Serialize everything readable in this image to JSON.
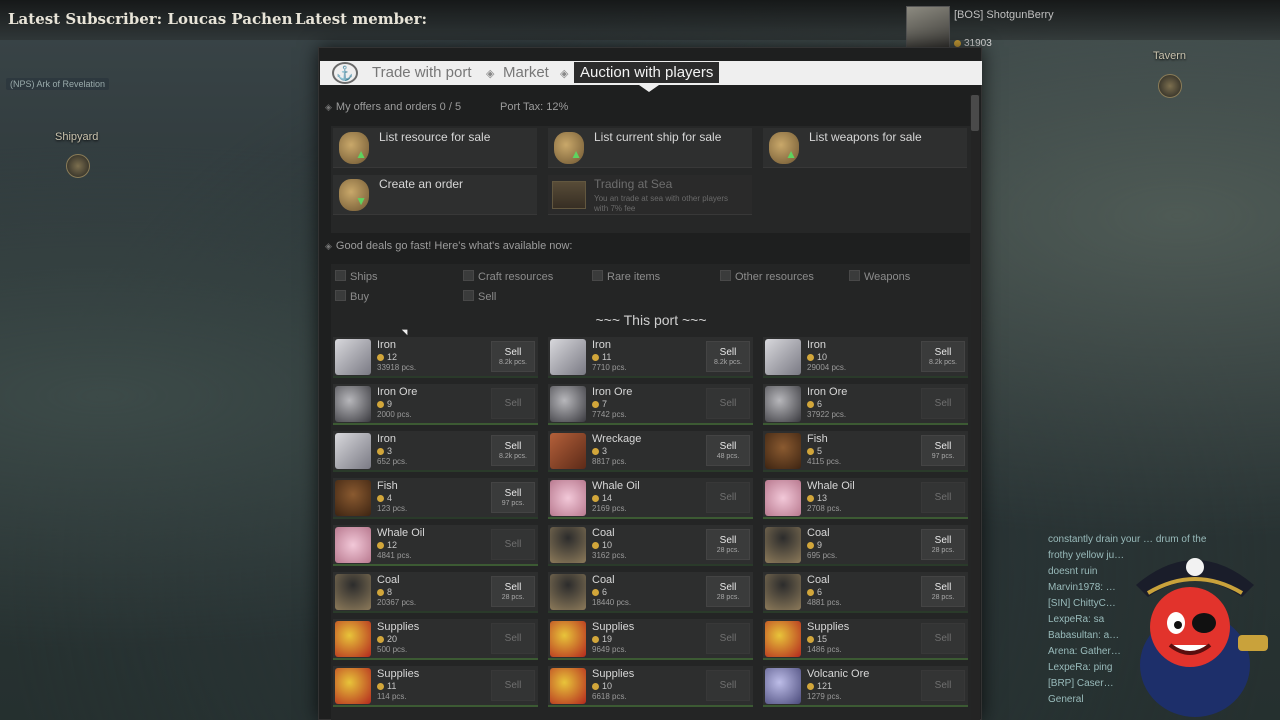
{
  "stream": {
    "latest_subscriber": "Latest Subscriber: Loucas Pachen",
    "latest_member": "Latest member:"
  },
  "player": {
    "name": "[BOS] ShotgunBerry",
    "coins": "31903"
  },
  "map": {
    "shipyard": "Shipyard",
    "tavern": "Tavern",
    "nps_label": "(NPS) Ark of Revelation"
  },
  "breadcrumb": {
    "trade": "Trade with port",
    "market": "Market",
    "auction": "Auction with players"
  },
  "offers": {
    "header": "My offers and orders 0 / 5",
    "tax": "Port Tax: 12%"
  },
  "actions": [
    {
      "label": "List resource for sale",
      "arrow": "up",
      "sub": ""
    },
    {
      "label": "List current ship for sale",
      "arrow": "up",
      "sub": ""
    },
    {
      "label": "List weapons for sale",
      "arrow": "up",
      "sub": ""
    },
    {
      "label": "Create an order",
      "arrow": "down",
      "sub": ""
    },
    {
      "label": "Trading at Sea",
      "arrow": "",
      "sub": "You an trade at sea with other players with 7% fee"
    }
  ],
  "deals_header": "Good deals go fast! Here's what's available now:",
  "filters": [
    "Ships",
    "Craft resources",
    "Rare items",
    "Other resources",
    "Weapons",
    "Buy",
    "Sell"
  ],
  "port_title": "~~~ This port ~~~",
  "items": [
    {
      "name": "Iron",
      "price": "12",
      "qty": "33918 pcs.",
      "sell": "Sell",
      "stock": "8.2k pcs.",
      "enabled": true,
      "icon": "iron-icon"
    },
    {
      "name": "Iron",
      "price": "11",
      "qty": "7710 pcs.",
      "sell": "Sell",
      "stock": "8.2k pcs.",
      "enabled": true,
      "icon": "iron-icon"
    },
    {
      "name": "Iron",
      "price": "10",
      "qty": "29004 pcs.",
      "sell": "Sell",
      "stock": "8.2k pcs.",
      "enabled": true,
      "icon": "iron-icon"
    },
    {
      "name": "Iron Ore",
      "price": "9",
      "qty": "2000 pcs.",
      "sell": "Sell",
      "stock": "",
      "enabled": false,
      "icon": "iron-ore-icon"
    },
    {
      "name": "Iron Ore",
      "price": "7",
      "qty": "7742 pcs.",
      "sell": "Sell",
      "stock": "",
      "enabled": false,
      "icon": "iron-ore-icon"
    },
    {
      "name": "Iron Ore",
      "price": "6",
      "qty": "37922 pcs.",
      "sell": "Sell",
      "stock": "",
      "enabled": false,
      "icon": "iron-ore-icon"
    },
    {
      "name": "Iron",
      "price": "3",
      "qty": "652 pcs.",
      "sell": "Sell",
      "stock": "8.2k pcs.",
      "enabled": true,
      "icon": "iron-icon"
    },
    {
      "name": "Wreckage",
      "price": "3",
      "qty": "8817 pcs.",
      "sell": "Sell",
      "stock": "48 pcs.",
      "enabled": true,
      "icon": "wreckage-icon"
    },
    {
      "name": "Fish",
      "price": "5",
      "qty": "4115 pcs.",
      "sell": "Sell",
      "stock": "97 pcs.",
      "enabled": true,
      "icon": "fish-icon"
    },
    {
      "name": "Fish",
      "price": "4",
      "qty": "123 pcs.",
      "sell": "Sell",
      "stock": "97 pcs.",
      "enabled": true,
      "icon": "fish-icon"
    },
    {
      "name": "Whale Oil",
      "price": "14",
      "qty": "2169 pcs.",
      "sell": "Sell",
      "stock": "",
      "enabled": false,
      "icon": "whale-oil-icon"
    },
    {
      "name": "Whale Oil",
      "price": "13",
      "qty": "2708 pcs.",
      "sell": "Sell",
      "stock": "",
      "enabled": false,
      "icon": "whale-oil-icon"
    },
    {
      "name": "Whale Oil",
      "price": "12",
      "qty": "4841 pcs.",
      "sell": "Sell",
      "stock": "",
      "enabled": false,
      "icon": "whale-oil-icon"
    },
    {
      "name": "Coal",
      "price": "10",
      "qty": "3162 pcs.",
      "sell": "Sell",
      "stock": "28 pcs.",
      "enabled": true,
      "icon": "coal-icon"
    },
    {
      "name": "Coal",
      "price": "9",
      "qty": "695 pcs.",
      "sell": "Sell",
      "stock": "28 pcs.",
      "enabled": true,
      "icon": "coal-icon"
    },
    {
      "name": "Coal",
      "price": "8",
      "qty": "20367 pcs.",
      "sell": "Sell",
      "stock": "28 pcs.",
      "enabled": true,
      "icon": "coal-icon"
    },
    {
      "name": "Coal",
      "price": "6",
      "qty": "18440 pcs.",
      "sell": "Sell",
      "stock": "28 pcs.",
      "enabled": true,
      "icon": "coal-icon"
    },
    {
      "name": "Coal",
      "price": "6",
      "qty": "4881 pcs.",
      "sell": "Sell",
      "stock": "28 pcs.",
      "enabled": true,
      "icon": "coal-icon"
    },
    {
      "name": "Supplies",
      "price": "20",
      "qty": "500 pcs.",
      "sell": "Sell",
      "stock": "",
      "enabled": false,
      "icon": "supplies-icon"
    },
    {
      "name": "Supplies",
      "price": "19",
      "qty": "9649 pcs.",
      "sell": "Sell",
      "stock": "",
      "enabled": false,
      "icon": "supplies-icon"
    },
    {
      "name": "Supplies",
      "price": "15",
      "qty": "1486 pcs.",
      "sell": "Sell",
      "stock": "",
      "enabled": false,
      "icon": "supplies-icon"
    },
    {
      "name": "Supplies",
      "price": "11",
      "qty": "114 pcs.",
      "sell": "Sell",
      "stock": "",
      "enabled": false,
      "icon": "supplies-icon"
    },
    {
      "name": "Supplies",
      "price": "10",
      "qty": "6618 pcs.",
      "sell": "Sell",
      "stock": "",
      "enabled": false,
      "icon": "supplies-icon"
    },
    {
      "name": "Volcanic Ore",
      "price": "121",
      "qty": "1279 pcs.",
      "sell": "Sell",
      "stock": "",
      "enabled": false,
      "icon": "volcanic-ore-icon"
    }
  ],
  "chat": [
    "constantly drain your … drum of the",
    "frothy yellow ju…",
    "doesnt ruin",
    "Marvin1978: …",
    "[SIN] ChittyC…",
    "LexpeRa: sa",
    "Babasultan: a…",
    "Arena: Gather…",
    "LexpeRa: ping",
    "[BRP] Caser…",
    "General"
  ],
  "colors": {
    "panel_bg": "#1e1f1f",
    "breadcrumb_bg": "#efefef",
    "coin": "#d2a63a",
    "sell_enabled": "#3a3b3b"
  }
}
